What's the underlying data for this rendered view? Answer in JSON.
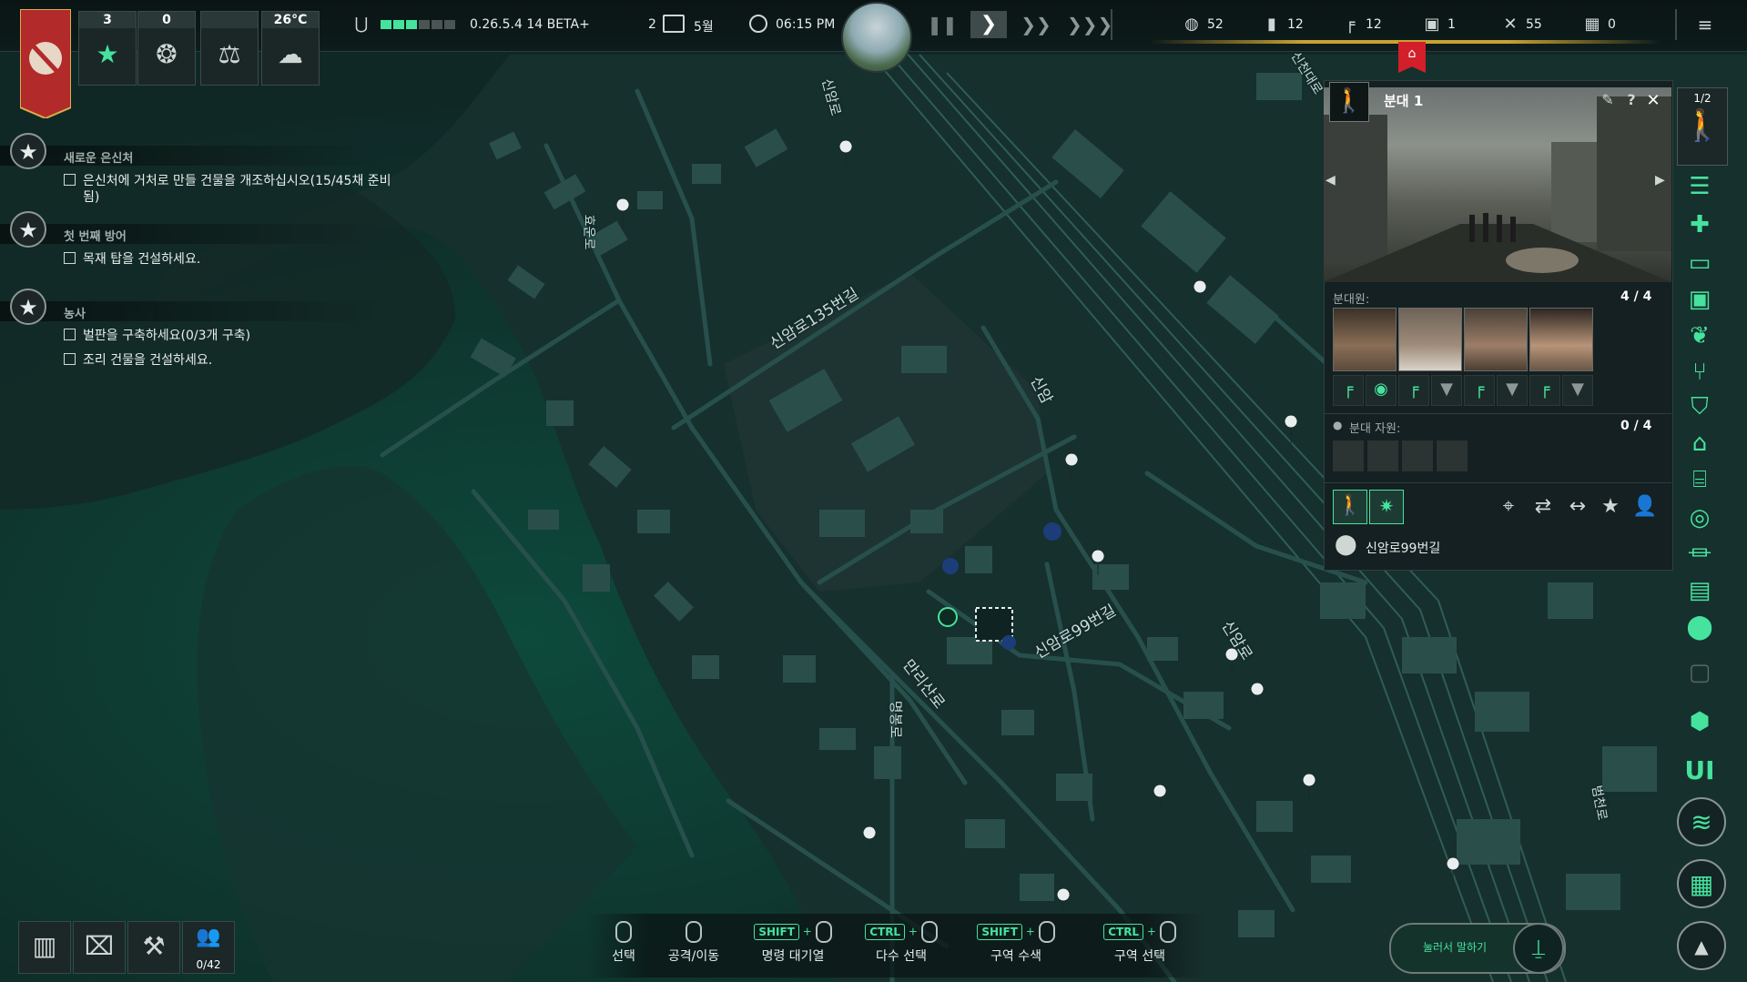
{
  "top_stats": [
    {
      "value": "3",
      "icon": "star-icon"
    },
    {
      "value": "0",
      "icon": "prayer-icon"
    },
    {
      "value": "",
      "icon": "scales-icon"
    },
    {
      "value": "26°C",
      "icon": "weather-icon"
    }
  ],
  "version": "0.26.5.4 14 BETA+",
  "date": {
    "day": "2",
    "month": "5월"
  },
  "time": "06:15  PM",
  "resources": [
    {
      "icon": "shield-icon",
      "value": "52"
    },
    {
      "icon": "ammo-icon",
      "value": "12"
    },
    {
      "icon": "gun-icon",
      "value": "12"
    },
    {
      "icon": "fuel-icon",
      "value": "1"
    },
    {
      "icon": "tools-icon",
      "value": "55"
    },
    {
      "icon": "crate-icon",
      "value": "0"
    }
  ],
  "objectives": [
    {
      "title": "새로운 은신처",
      "items": [
        "은신처에 거처로 만들 건물을 개조하십시오(15/45채 준비",
        "됨)"
      ]
    },
    {
      "title": "첫 번째 방어",
      "items": [
        "목재 탑을 건설하세요."
      ]
    },
    {
      "title": "농사",
      "items": [
        "벌판을 구축하세요(0/3개 구축)",
        "조리 건물을 건설하세요."
      ]
    }
  ],
  "squad": {
    "name": "분대 1",
    "page": "1/2",
    "members_label": "분대원:",
    "members_count": "4 / 4",
    "volunteers_label": "분대 자원:",
    "volunteers_count": "0 / 4",
    "location": "신암로99번길"
  },
  "map_labels": {
    "road1": "신암로135번길",
    "road2": "신암",
    "road3": "신암로99번길",
    "road4": "만리산로",
    "road5": "신암로",
    "road6": "신천대로",
    "road7": "신암로",
    "road8": "명봉로",
    "road9": "범천로",
    "road10": "효운로"
  },
  "bottom_buttons": {
    "population": "0/42"
  },
  "hints": [
    {
      "keys": "",
      "label": "선택"
    },
    {
      "keys": "",
      "label": "공격/이동"
    },
    {
      "keys": "SHIFT",
      "label": "명령 대기열"
    },
    {
      "keys": "CTRL",
      "label": "다수 선택"
    },
    {
      "keys": "SHIFT",
      "label": "구역 수색"
    },
    {
      "keys": "CTRL",
      "label": "구역 선택"
    }
  ],
  "push_to_talk": "눌러서 말하기",
  "colors": {
    "accent": "#45e39e",
    "map_bg": "#0f2826",
    "road": "#27504c",
    "panel": "#142021",
    "banner_red": "#b22a2a"
  }
}
